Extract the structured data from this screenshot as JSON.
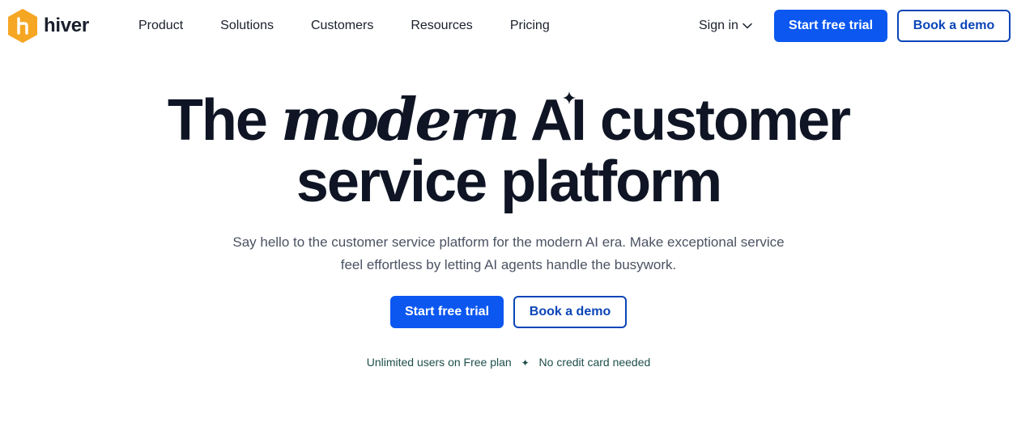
{
  "brand": {
    "name": "hiver",
    "color": "#f5a623"
  },
  "nav": {
    "links": [
      "Product",
      "Solutions",
      "Customers",
      "Resources",
      "Pricing"
    ],
    "signin": "Sign in",
    "primary_cta": "Start free trial",
    "secondary_cta": "Book a demo"
  },
  "hero": {
    "title_part1": "The",
    "title_emphasis": "modern",
    "title_part2": "AI",
    "title_part3": "customer",
    "title_line2": "service platform",
    "subtitle": "Say hello to the customer service platform for the modern AI era. Make exceptional service feel effortless by letting AI agents handle the busywork.",
    "primary_cta": "Start free trial",
    "secondary_cta": "Book a demo",
    "note_left": "Unlimited users on Free plan",
    "note_separator": "✦",
    "note_right": "No credit card needed"
  },
  "colors": {
    "primary": "#0b57f0",
    "outline": "#0b45b8",
    "text": "#0f1524",
    "note": "#1d4e4a"
  }
}
